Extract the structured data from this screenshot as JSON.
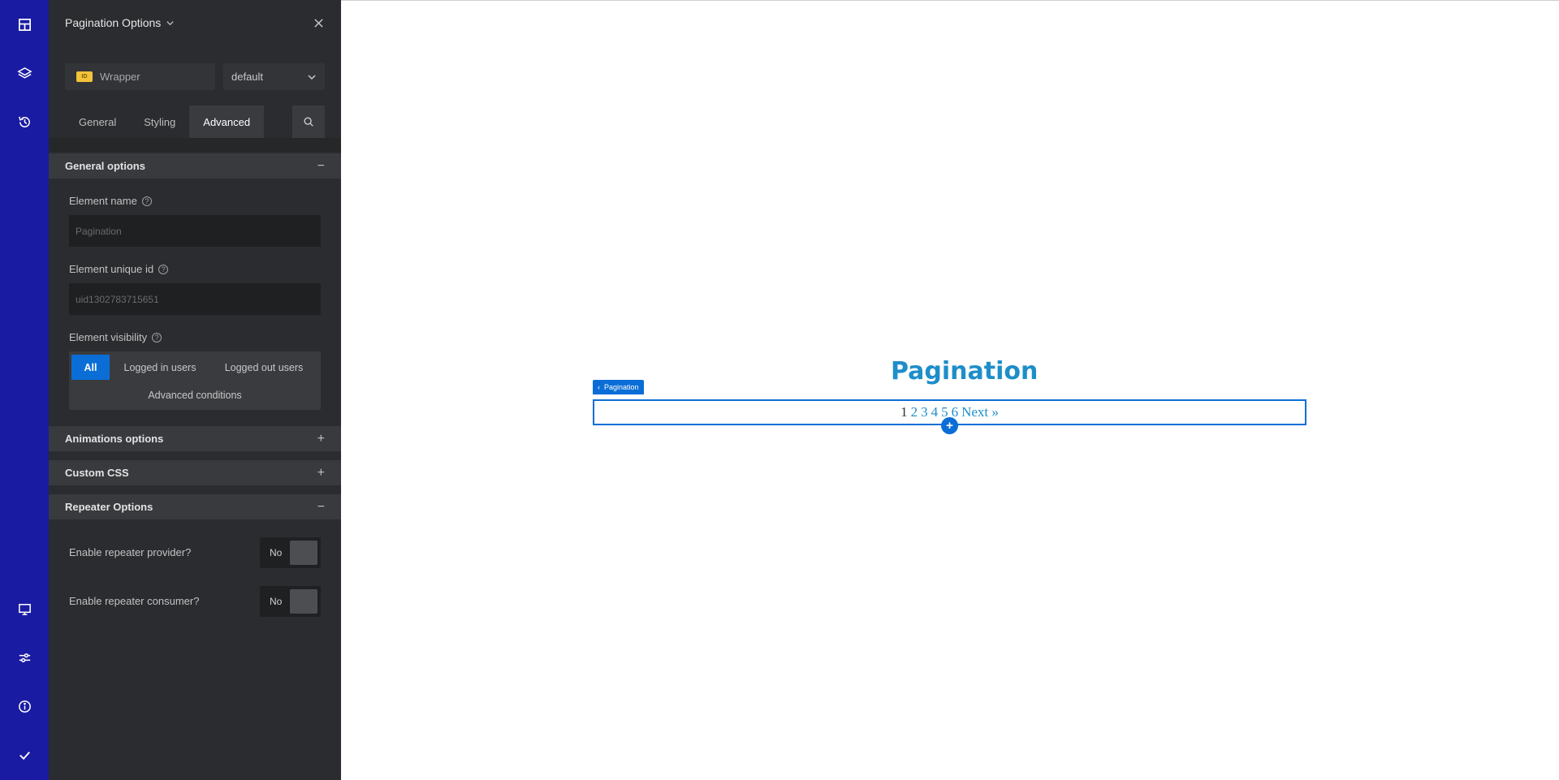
{
  "rail": {
    "items": [
      {
        "icon": "layout-icon"
      },
      {
        "icon": "layers-icon"
      },
      {
        "icon": "history-icon"
      },
      {
        "icon": "desktop-icon"
      },
      {
        "icon": "sliders-icon"
      },
      {
        "icon": "info-icon"
      },
      {
        "icon": "check-icon"
      }
    ],
    "color": "#1a1ba3"
  },
  "panel": {
    "title": "Pagination Options",
    "wrapper": {
      "badge": "ID",
      "label": "Wrapper"
    },
    "preset_select": "default",
    "tabs": [
      "General",
      "Styling",
      "Advanced"
    ],
    "active_tab": "Advanced",
    "sections": {
      "general": {
        "title": "General options",
        "sign": "−",
        "element_name_label": "Element name",
        "element_name_placeholder": "Pagination",
        "element_uid_label": "Element unique id",
        "element_uid_placeholder": "uid1302783715651",
        "visibility_label": "Element visibility",
        "visibility_options": [
          "All",
          "Logged in users",
          "Logged out users"
        ],
        "visibility_selected": "All",
        "advanced_conditions": "Advanced conditions"
      },
      "animations": {
        "title": "Animations options",
        "sign": "+"
      },
      "custom_css": {
        "title": "Custom CSS",
        "sign": "+"
      },
      "repeater": {
        "title": "Repeater Options",
        "sign": "−",
        "provider_label": "Enable repeater provider?",
        "provider_value": "No",
        "consumer_label": "Enable repeater consumer?",
        "consumer_value": "No"
      }
    }
  },
  "canvas": {
    "heading": "Pagination",
    "element_tag": "Pagination",
    "pagination": {
      "current": "1",
      "pages": [
        "2",
        "3",
        "4",
        "5",
        "6"
      ],
      "next": "Next »"
    },
    "add_symbol": "+",
    "accent": "#0b6ed6",
    "heading_color": "#1e8ec9"
  }
}
